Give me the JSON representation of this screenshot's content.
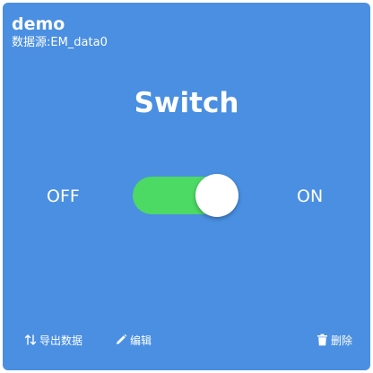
{
  "card": {
    "title": "demo",
    "data_source": "数据源:EM_data0"
  },
  "widget": {
    "label": "Switch",
    "off_label": "OFF",
    "on_label": "ON",
    "state": "on",
    "track_color": "#4cd964",
    "knob_color": "#ffffff"
  },
  "footer": {
    "export_label": "导出数据",
    "export_icon": "swap-vertical-icon",
    "edit_label": "编辑",
    "edit_icon": "pencil-icon",
    "delete_label": "删除",
    "delete_icon": "trash-icon"
  },
  "colors": {
    "card_background": "#4a8fe2",
    "text": "#ffffff"
  }
}
